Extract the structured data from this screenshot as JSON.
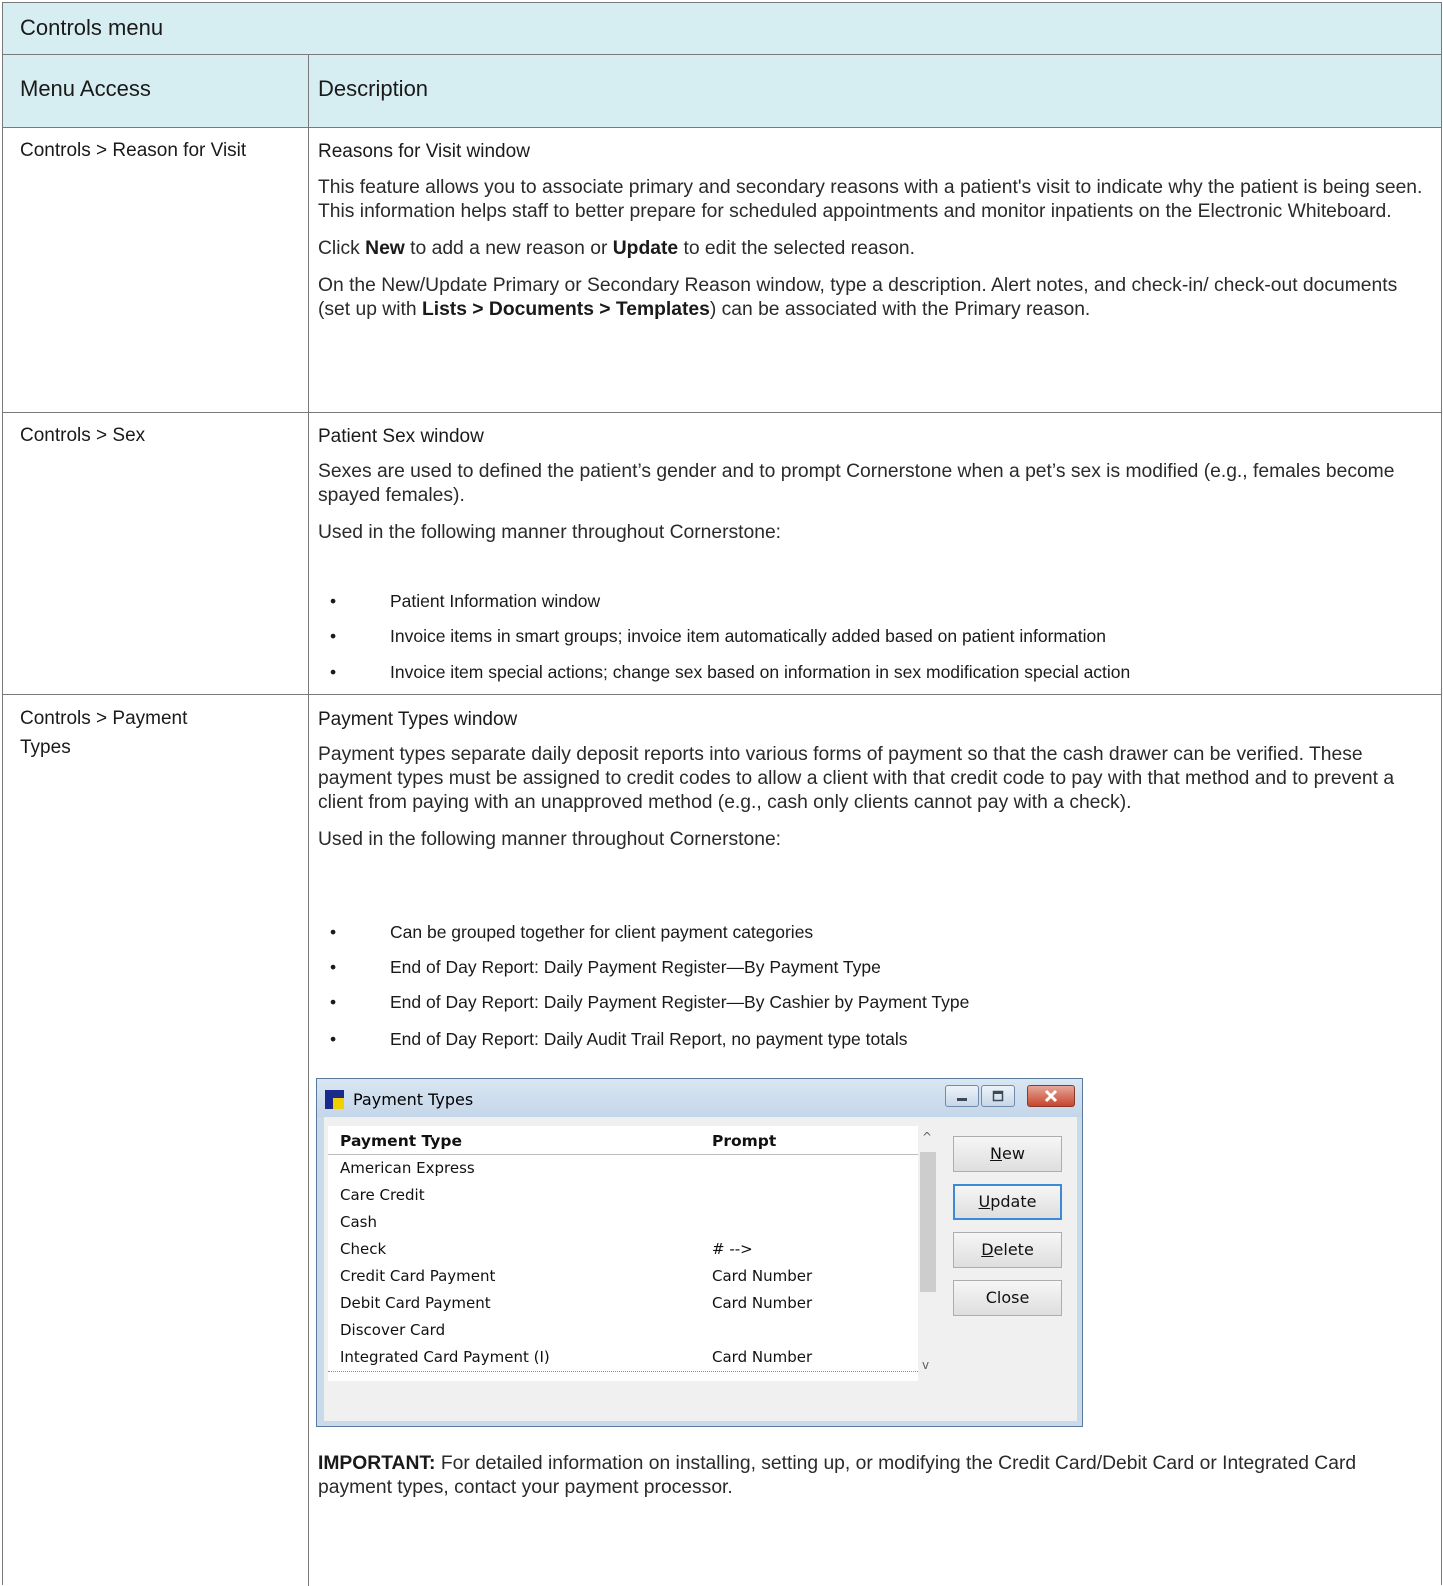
{
  "table_title": "Controls menu",
  "columns": {
    "menu_access": "Menu Access",
    "description": "Description"
  },
  "rows": [
    {
      "menu_access": "Controls > Reason for Visit",
      "title": "Reasons for Visit window",
      "p1": "This feature allows you to associate primary and secondary reasons with a patient's visit to indicate why the patient is being seen. This information helps staff to better prepare for scheduled appointments and monitor inpatients on the Electronic Whiteboard.",
      "p2": {
        "t1": "Click ",
        "b1": "New",
        "t2": " to add a new reason or ",
        "b2": "Update",
        "t3": " to edit the selected reason."
      },
      "p3": {
        "t1": "On the New/Update Primary or Secondary Reason window, type a description. Alert notes, and check-in/ check-out documents (set up with ",
        "b1": "Lists > Documents > Templates",
        "t2": ") can be associated with the Primary reason."
      }
    },
    {
      "menu_access": "Controls > Sex",
      "title": "Patient Sex window",
      "p1": "Sexes are used to defined the patient’s gender and to prompt Cornerstone when a pet’s sex is modified (e.g., females become spayed females).",
      "p2": "Used in the following manner throughout Cornerstone:",
      "bullets": [
        "Patient Information window",
        "Invoice items in smart groups; invoice item automatically added based on patient information",
        "Invoice item special actions; change sex based on information in sex modification special action"
      ]
    },
    {
      "menu_access_1": "Controls > Payment",
      "menu_access_2": "Types",
      "title": "Payment Types window",
      "p1": "Payment types separate daily deposit reports into various forms of payment so that the cash drawer can be verified. These payment types must be assigned to credit codes to allow a client with that credit code to pay with that method and to prevent a client from paying with an unapproved method (e.g., cash only clients cannot pay with a check).",
      "p2": "Used in the following manner throughout Cornerstone:",
      "bullets": [
        "Can be grouped together for client payment categories",
        "End of Day Report: Daily Payment Register—By Payment Type",
        "End of Day Report: Daily Payment Register—By Cashier by Payment Type",
        "End of Day Report: Daily Audit Trail Report, no payment type totals"
      ],
      "important_label": "IMPORTANT:",
      "important_text": " For detailed information on installing, setting up, or modifying the Credit Card/Debit Card or Integrated Card payment types, contact your payment processor."
    }
  ],
  "bullet_glyph": "•",
  "window": {
    "title": "Payment Types",
    "col_payment_type": "Payment Type",
    "col_prompt": "Prompt",
    "items": [
      {
        "type": "American Express",
        "prompt": ""
      },
      {
        "type": "Care Credit",
        "prompt": ""
      },
      {
        "type": "Cash",
        "prompt": ""
      },
      {
        "type": "Check",
        "prompt": "# -->"
      },
      {
        "type": "Credit Card Payment",
        "prompt": "Card Number"
      },
      {
        "type": "Debit Card Payment",
        "prompt": "Card Number"
      },
      {
        "type": "Discover Card",
        "prompt": ""
      },
      {
        "type": "Integrated Card Payment (I)",
        "prompt": "Card Number"
      }
    ],
    "buttons": {
      "new": {
        "mnemonic": "N",
        "rest": "ew"
      },
      "update": {
        "mnemonic": "U",
        "rest": "pdate"
      },
      "delete": {
        "mnemonic": "D",
        "rest": "elete"
      },
      "close": "Close"
    },
    "scroll_up": "^",
    "scroll_down": "v",
    "colors": {
      "title_bar": "#c4d6e9",
      "close_button": "#c7452d",
      "focus": "#3a8ad8"
    }
  },
  "colors": {
    "header_bg": "#d6eef2",
    "border": "#7a7a7a"
  }
}
